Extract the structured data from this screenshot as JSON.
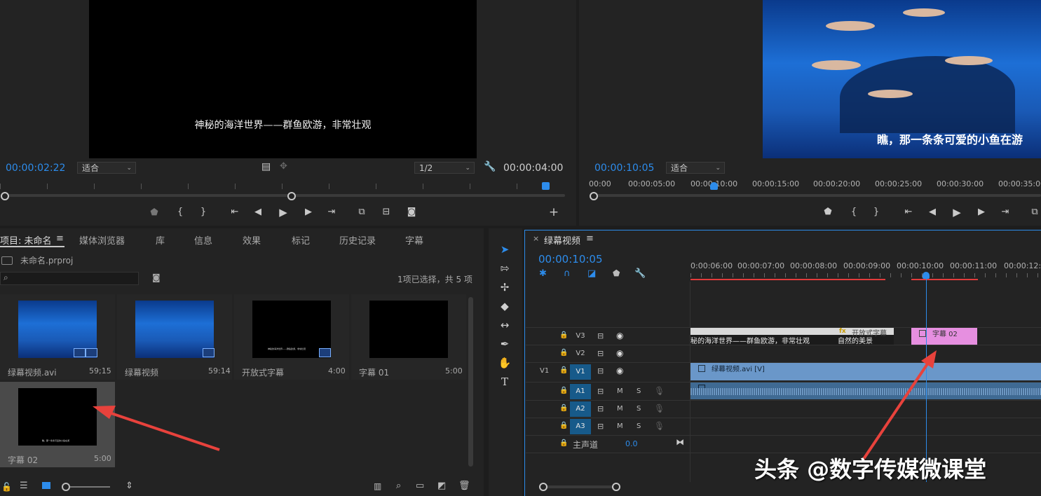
{
  "source_monitor": {
    "subtitle": "神秘的海洋世界——群鱼欧游，非常壮观",
    "timecode": "00:00:02:22",
    "fit_select": "适合",
    "resolution_select": "1/2",
    "duration": "00:00:04:00",
    "add_icon": "plus-icon"
  },
  "program_monitor": {
    "subtitle": "瞧，那一条条可爱的小鱼在游",
    "timecode": "00:00:10:05",
    "fit_select": "适合",
    "ruler": [
      "00:00",
      "00:00:05:00",
      "00:00:10:00",
      "00:00:15:00",
      "00:00:20:00",
      "00:00:25:00",
      "00:00:30:00",
      "00:00:35:00"
    ]
  },
  "project_panel": {
    "tabs": [
      "项目: 未命名",
      "媒体浏览器",
      "库",
      "信息",
      "效果",
      "标记",
      "历史记录",
      "字幕"
    ],
    "file_name": "未命名.prproj",
    "selection_info": "1项已选择，共 5 项",
    "items": [
      {
        "name": "绿幕视频.avi",
        "duration": "59;15"
      },
      {
        "name": "绿幕视频",
        "duration": "59:14"
      },
      {
        "name": "开放式字幕",
        "duration": "4:00"
      },
      {
        "name": "字幕 01",
        "duration": "5:00"
      },
      {
        "name": "字幕 02",
        "duration": "5:00"
      }
    ],
    "thumb_caption_small": "神秘的海洋世界——群鱼欧游，非常壮观",
    "thumb_caption_small2": "瞧，那一条条可爱的小鱼在游"
  },
  "timeline": {
    "sequence_name": "绿幕视频",
    "close": "×",
    "timecode": "00:00:10:05",
    "ruler": [
      "0:00:06:00",
      "00:00:07:00",
      "00:00:08:00",
      "00:00:09:00",
      "00:00:10:00",
      "00:00:11:00",
      "00:00:12:00"
    ],
    "tracks_video": [
      "V3",
      "V2",
      "V1"
    ],
    "source_patch": "V1",
    "tracks_audio": [
      "A1",
      "A2",
      "A3"
    ],
    "master_label": "主声道",
    "master_value": "0.0",
    "clip_v3_text": "秘的海洋世界——群鱼欧游，非常壮观",
    "clip_v3_open": "开放式字幕",
    "clip_v3_nature": "自然的美景",
    "clip_v3_title02": "字幕 02",
    "clip_v1": "绿幕视频.avi [V]",
    "fx": "fx"
  },
  "watermark": "头条 @数字传媒微课堂",
  "colors": {
    "accent": "#2d8ceb",
    "title02_clip": "#e68fe0",
    "video_clip": "#6a97c9",
    "arrow": "#e8423c"
  }
}
